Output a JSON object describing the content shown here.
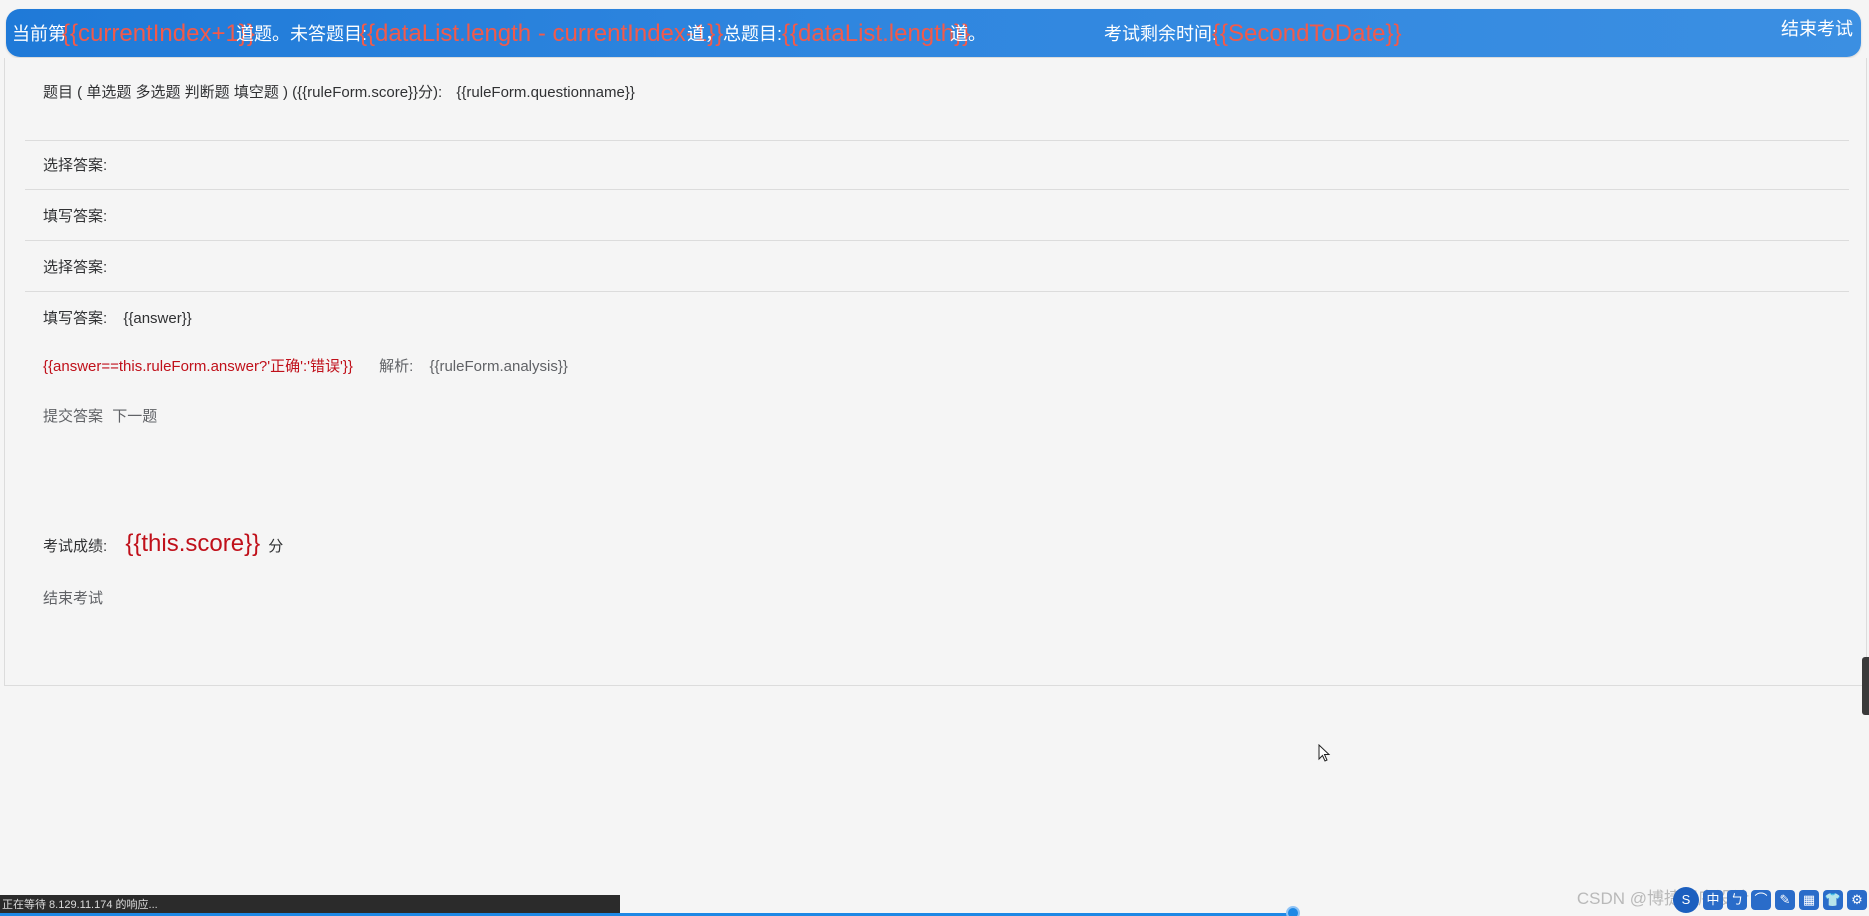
{
  "header": {
    "seg1_prefix": "当前第",
    "seg1_value": "{{currentIndex+1}}",
    "seg1_suffix": "道题。未答题目:",
    "seg2_value": "{{dataList.length - currentIndex-1}}",
    "seg2_suffix": "道，总题目:",
    "seg3_value": "{{dataList.length}}",
    "seg3_suffix": "道。",
    "timer_label": "考试剩余时间:",
    "timer_value": "{{SecondToDate}}",
    "end_button": "结束考试"
  },
  "question": {
    "title": "题目 ( 单选题 多选题 判断题 填空题 ) ({{ruleForm.score}}分):",
    "name": "{{ruleForm.questionname}}"
  },
  "answers": {
    "choose_label_1": "选择答案:",
    "fill_label_1": "填写答案:",
    "choose_label_2": "选择答案:",
    "fill_label_2": "填写答案:",
    "fill_value_2": "{{answer}}"
  },
  "result": {
    "judge": "{{answer==this.ruleForm.answer?'正确':'错误'}}",
    "analysis_label": "解析:",
    "analysis_value": "{{ruleForm.analysis}}"
  },
  "actions": {
    "submit": "提交答案",
    "next": "下一题"
  },
  "score": {
    "label": "考试成绩:",
    "value": "{{this.score}}",
    "unit": "分"
  },
  "footer_action": "结束考试",
  "status_bar": {
    "text": "正在等待 8.129.11.174 的响应..."
  },
  "watermark": "CSDN @博捷程序设计",
  "tray": [
    "中",
    "ㄅ",
    "⌒",
    "✎",
    "▦",
    "👕",
    "⚙"
  ],
  "colors": {
    "header_blue": "#2f86df",
    "highlight_red": "#c0101a"
  }
}
